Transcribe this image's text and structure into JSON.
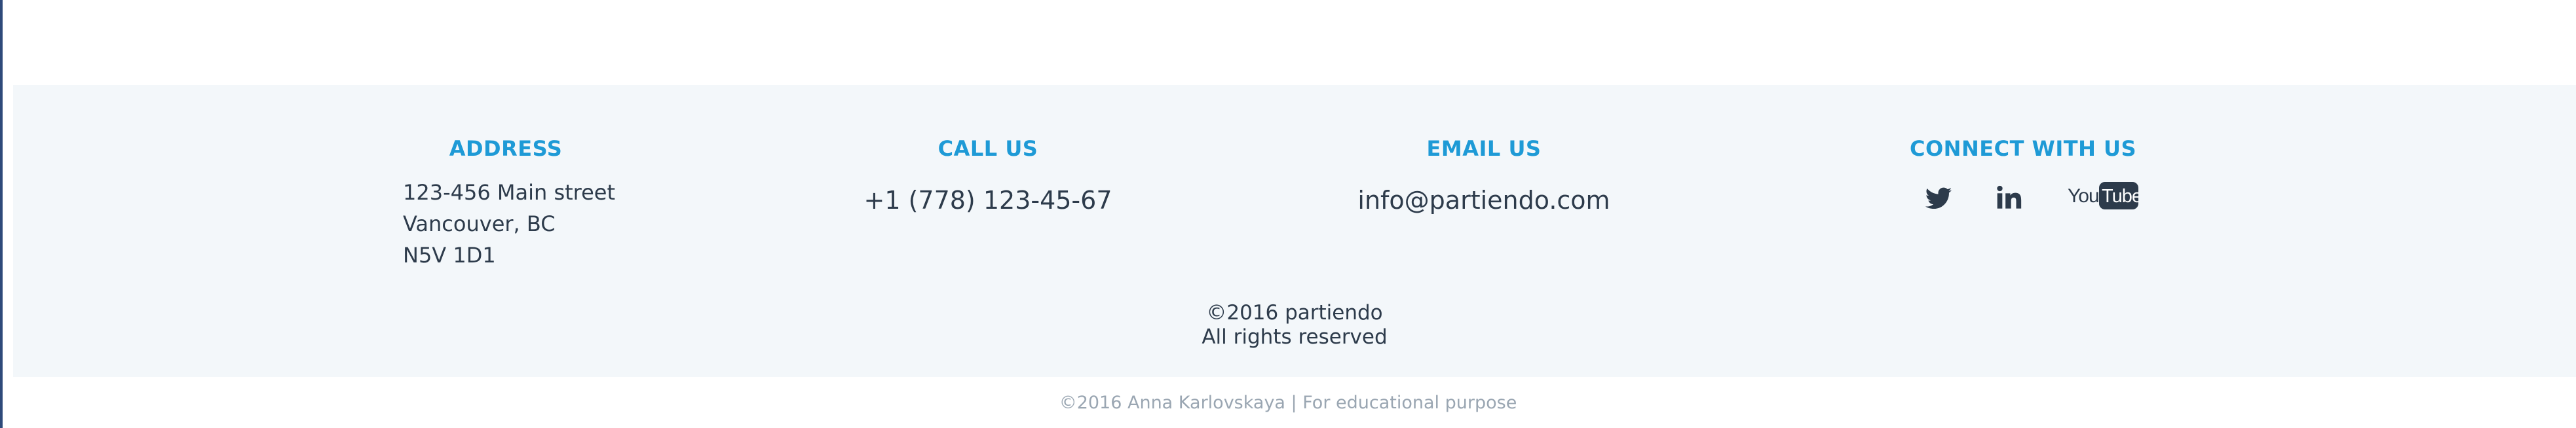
{
  "footer": {
    "address": {
      "heading": "ADDRESS",
      "lines": [
        "123-456 Main street",
        "Vancouver, BC",
        "N5V 1D1"
      ]
    },
    "call": {
      "heading": "CALL US",
      "phone": "+1 (778) 123-45-67"
    },
    "email": {
      "heading": "EMAIL US",
      "address": "info@partiendo.com"
    },
    "connect": {
      "heading": "CONNECT WITH US",
      "icons": [
        "twitter-icon",
        "linkedin-icon",
        "youtube-icon"
      ],
      "youtube_logo_text": [
        "You",
        "Tube"
      ]
    },
    "copyright": {
      "line1": "©2016 partiendo",
      "line2": "All rights reserved"
    }
  },
  "credit": "©2016 Anna Karlovskaya | For educational purpose",
  "colors": {
    "accent": "#1e9ad6",
    "text": "#2d3b4b",
    "panel": "#f3f7fa",
    "muted": "#9aa6b2"
  }
}
